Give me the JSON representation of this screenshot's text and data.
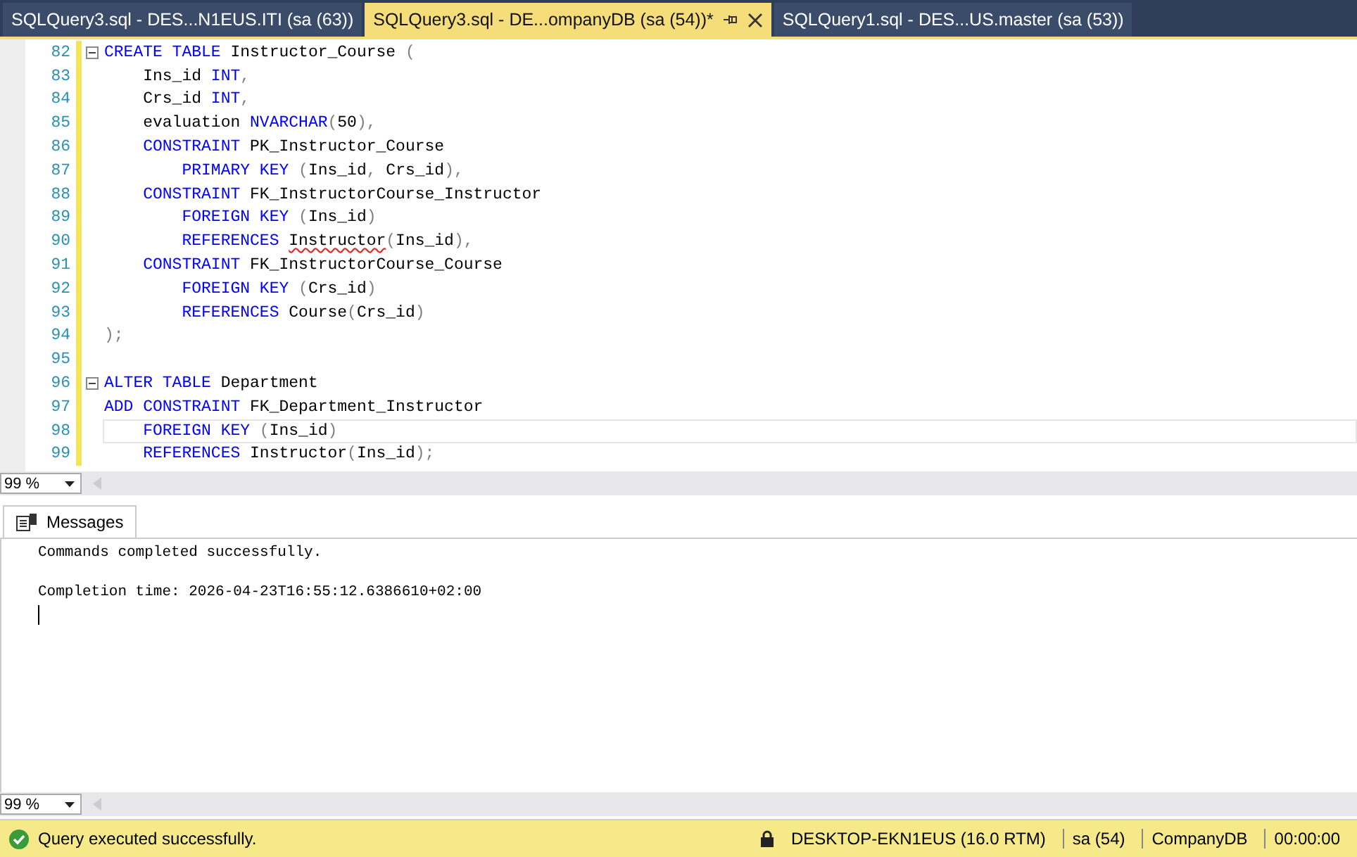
{
  "tabs": [
    {
      "label": "SQLQuery3.sql - DES...N1EUS.ITI (sa (63))",
      "selected": false
    },
    {
      "label": "SQLQuery3.sql - DE...ompanyDB (sa (54))*",
      "selected": true
    },
    {
      "label": "SQLQuery1.sql - DES...US.master (sa (53))",
      "selected": false
    }
  ],
  "editor": {
    "lines": [
      {
        "number": "82",
        "fold": true,
        "current": false,
        "tokens": [
          {
            "text": "CREATE TABLE",
            "kind": "keyword"
          },
          {
            "text": " Instructor_Course ",
            "kind": "ident"
          },
          {
            "text": "(",
            "kind": "punct"
          }
        ]
      },
      {
        "number": "83",
        "fold": false,
        "current": false,
        "tokens": [
          {
            "text": "    Ins_id ",
            "kind": "ident"
          },
          {
            "text": "INT",
            "kind": "keyword"
          },
          {
            "text": ",",
            "kind": "punct"
          }
        ]
      },
      {
        "number": "84",
        "fold": false,
        "current": false,
        "tokens": [
          {
            "text": "    Crs_id ",
            "kind": "ident"
          },
          {
            "text": "INT",
            "kind": "keyword"
          },
          {
            "text": ",",
            "kind": "punct"
          }
        ]
      },
      {
        "number": "85",
        "fold": false,
        "current": false,
        "tokens": [
          {
            "text": "    evaluation ",
            "kind": "ident"
          },
          {
            "text": "NVARCHAR",
            "kind": "keyword"
          },
          {
            "text": "(",
            "kind": "punct"
          },
          {
            "text": "50",
            "kind": "ident"
          },
          {
            "text": "),",
            "kind": "punct"
          }
        ]
      },
      {
        "number": "86",
        "fold": false,
        "current": false,
        "tokens": [
          {
            "text": "    CONSTRAINT",
            "kind": "keyword"
          },
          {
            "text": " PK_Instructor_Course",
            "kind": "ident"
          }
        ]
      },
      {
        "number": "87",
        "fold": false,
        "current": false,
        "tokens": [
          {
            "text": "        PRIMARY KEY",
            "kind": "keyword"
          },
          {
            "text": " (",
            "kind": "punct"
          },
          {
            "text": "Ins_id",
            "kind": "ident"
          },
          {
            "text": ", ",
            "kind": "punct"
          },
          {
            "text": "Crs_id",
            "kind": "ident"
          },
          {
            "text": "),",
            "kind": "punct"
          }
        ]
      },
      {
        "number": "88",
        "fold": false,
        "current": false,
        "tokens": [
          {
            "text": "    CONSTRAINT",
            "kind": "keyword"
          },
          {
            "text": " FK_InstructorCourse_Instructor",
            "kind": "ident"
          }
        ]
      },
      {
        "number": "89",
        "fold": false,
        "current": false,
        "tokens": [
          {
            "text": "        FOREIGN KEY",
            "kind": "keyword"
          },
          {
            "text": " (",
            "kind": "punct"
          },
          {
            "text": "Ins_id",
            "kind": "ident"
          },
          {
            "text": ")",
            "kind": "punct"
          }
        ]
      },
      {
        "number": "90",
        "fold": false,
        "current": false,
        "tokens": [
          {
            "text": "        REFERENCES ",
            "kind": "keyword"
          },
          {
            "text": "Instructor",
            "kind": "error"
          },
          {
            "text": "(",
            "kind": "punct"
          },
          {
            "text": "Ins_id",
            "kind": "ident"
          },
          {
            "text": "),",
            "kind": "punct"
          }
        ]
      },
      {
        "number": "91",
        "fold": false,
        "current": false,
        "tokens": [
          {
            "text": "    CONSTRAINT",
            "kind": "keyword"
          },
          {
            "text": " FK_InstructorCourse_Course",
            "kind": "ident"
          }
        ]
      },
      {
        "number": "92",
        "fold": false,
        "current": false,
        "tokens": [
          {
            "text": "        FOREIGN KEY",
            "kind": "keyword"
          },
          {
            "text": " (",
            "kind": "punct"
          },
          {
            "text": "Crs_id",
            "kind": "ident"
          },
          {
            "text": ")",
            "kind": "punct"
          }
        ]
      },
      {
        "number": "93",
        "fold": false,
        "current": false,
        "tokens": [
          {
            "text": "        REFERENCES",
            "kind": "keyword"
          },
          {
            "text": " Course",
            "kind": "ident"
          },
          {
            "text": "(",
            "kind": "punct"
          },
          {
            "text": "Crs_id",
            "kind": "ident"
          },
          {
            "text": ")",
            "kind": "punct"
          }
        ]
      },
      {
        "number": "94",
        "fold": false,
        "current": false,
        "tokens": [
          {
            "text": ");",
            "kind": "punct"
          }
        ]
      },
      {
        "number": "95",
        "fold": false,
        "current": false
      },
      {
        "number": "96",
        "fold": true,
        "current": false,
        "tokens": [
          {
            "text": "ALTER TABLE",
            "kind": "keyword"
          },
          {
            "text": " Department",
            "kind": "ident"
          }
        ]
      },
      {
        "number": "97",
        "fold": false,
        "current": false,
        "tokens": [
          {
            "text": "ADD CONSTRAINT",
            "kind": "keyword"
          },
          {
            "text": " FK_Department_Instructor",
            "kind": "ident"
          }
        ]
      },
      {
        "number": "98",
        "fold": false,
        "current": true,
        "tokens": [
          {
            "text": "    FOREIGN KEY",
            "kind": "keyword"
          },
          {
            "text": " (",
            "kind": "punct"
          },
          {
            "text": "Ins_id",
            "kind": "ident"
          },
          {
            "text": ")",
            "kind": "punct"
          }
        ]
      },
      {
        "number": "99",
        "fold": false,
        "current": false,
        "tokens": [
          {
            "text": "    REFERENCES",
            "kind": "keyword"
          },
          {
            "text": " Instructor",
            "kind": "ident"
          },
          {
            "text": "(",
            "kind": "punct"
          },
          {
            "text": "Ins_id",
            "kind": "ident"
          },
          {
            "text": ");",
            "kind": "punct"
          }
        ]
      }
    ],
    "zoom": "99 %"
  },
  "results": {
    "tab": "Messages",
    "messages": [
      "Commands completed successfully.",
      "Completion time: 2026-04-23T16:55:12.6386610+02:00"
    ],
    "zoom": "99 %"
  },
  "status_bar": {
    "message": "Query executed successfully.",
    "server": "DESKTOP-EKN1EUS (16.0 RTM)",
    "user": "sa (54)",
    "database": "CompanyDB",
    "time": "00:00:00"
  }
}
